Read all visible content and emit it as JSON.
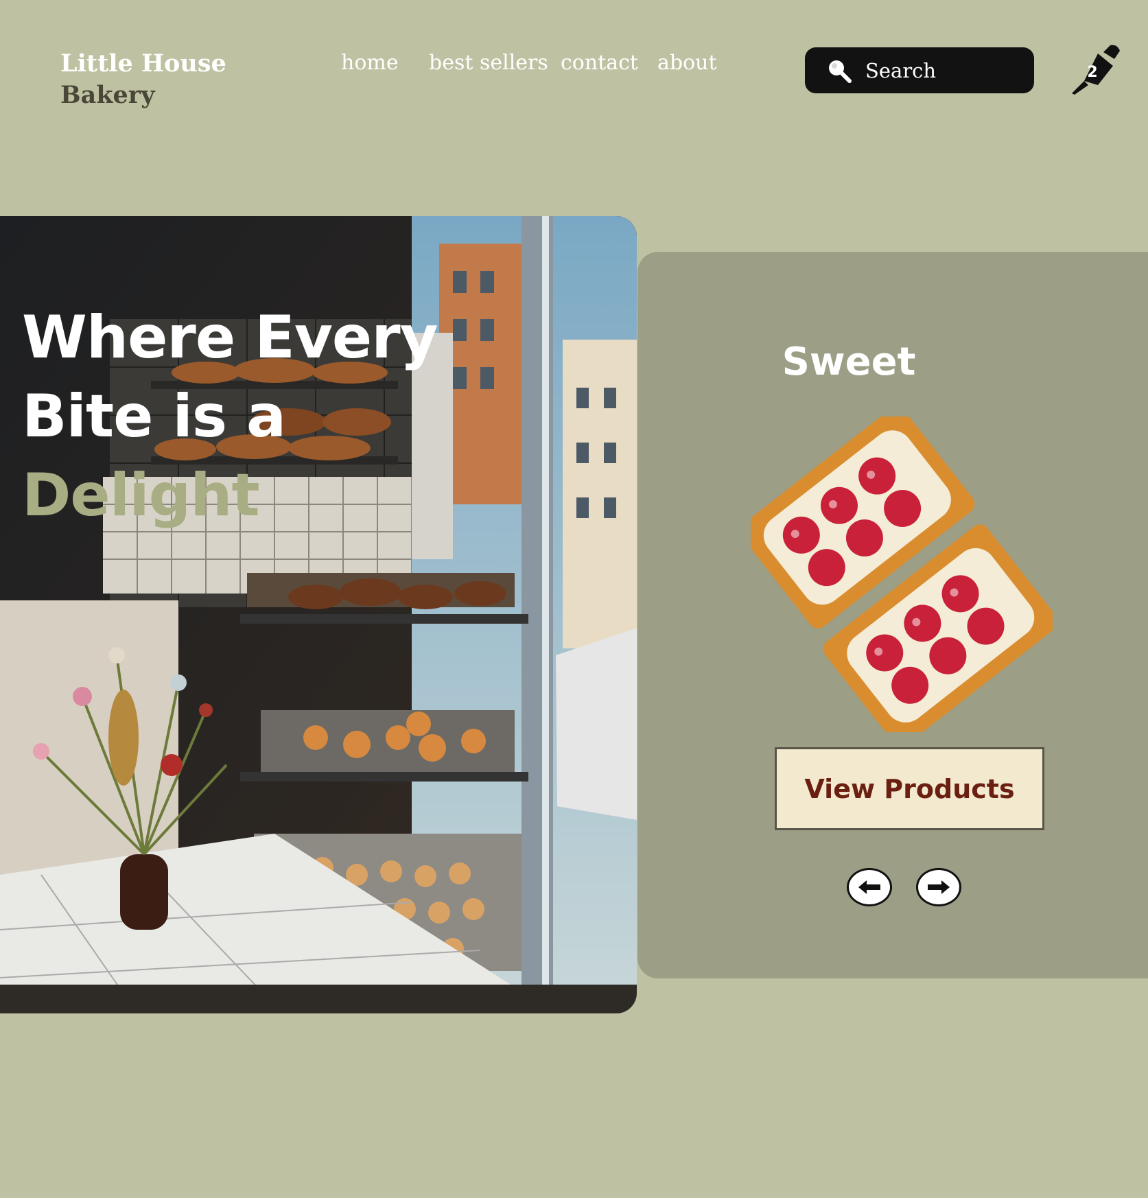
{
  "brand": {
    "line1": "Little House",
    "line2": "Bakery"
  },
  "nav": {
    "items": [
      {
        "label": "home"
      },
      {
        "label": "best sellers"
      },
      {
        "label": "contact"
      },
      {
        "label": "about"
      }
    ]
  },
  "search": {
    "label": "Search",
    "icon": "search-icon"
  },
  "cart": {
    "count": "2",
    "icon": "piping-bag-icon"
  },
  "hero": {
    "line1": "Where Every",
    "line2": "Bite is a",
    "line3": "Delight"
  },
  "panel": {
    "title": "Sweet",
    "button_label": "View Products",
    "prev_icon": "arrow-left-icon",
    "next_icon": "arrow-right-icon"
  },
  "colors": {
    "background": "#bfc2a2",
    "panel": "#9c9e86",
    "accent": "#a9ad83",
    "button_bg": "#f3e9cf",
    "button_text": "#6b1f10"
  }
}
